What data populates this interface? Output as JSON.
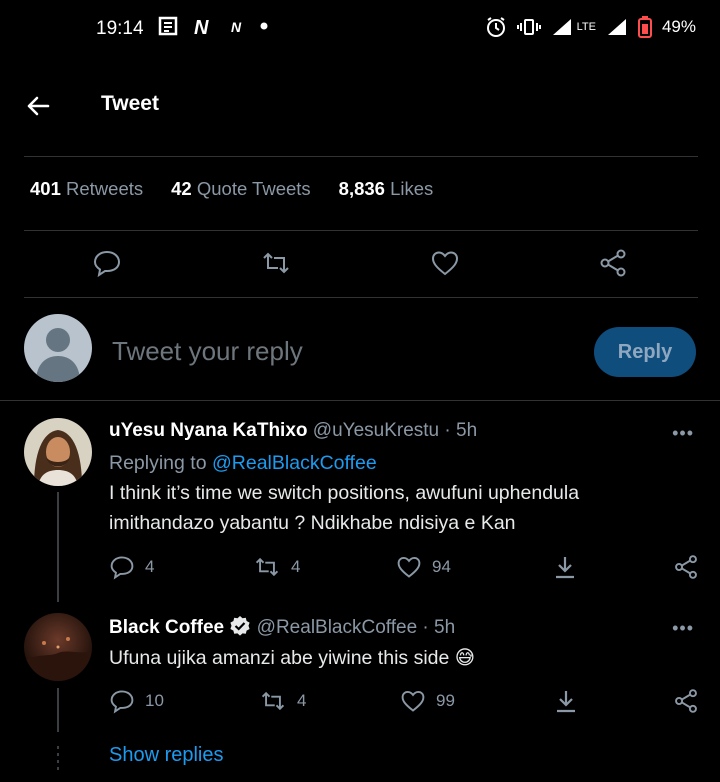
{
  "status_bar": {
    "time": "19:14",
    "lte": "LTE",
    "battery": "49%"
  },
  "header": {
    "title": "Tweet",
    "back_icon": "arrow-left-icon"
  },
  "stats": {
    "retweets_count": "401",
    "retweets_label": "Retweets",
    "quotes_count": "42",
    "quotes_label": "Quote Tweets",
    "likes_count": "8,836",
    "likes_label": "Likes"
  },
  "composer": {
    "placeholder": "Tweet your reply",
    "button": "Reply"
  },
  "replies": [
    {
      "name": "uYesu Nyana KaThixo",
      "handle": "@uYesuKrestu",
      "time": "· 5h",
      "replying_prefix": "Replying to",
      "replying_to": "@RealBlackCoffee",
      "text": "I think it’s time we switch positions, awufuni uphendula imithandazo yabantu ? Ndikhabe ndisiya e Kan",
      "replies": "4",
      "retweets": "4",
      "likes": "94"
    },
    {
      "name": "Black Coffee",
      "verified": true,
      "handle": "@RealBlackCoffee",
      "time": "· 5h",
      "text": "Ufuna ujika amanzi abe yiwine this side",
      "emoji": "😅",
      "replies": "10",
      "retweets": "4",
      "likes": "99"
    }
  ],
  "show_replies": "Show replies",
  "colors": {
    "accent": "#1d9bf0",
    "background": "#000000",
    "muted": "#8b98a5"
  }
}
